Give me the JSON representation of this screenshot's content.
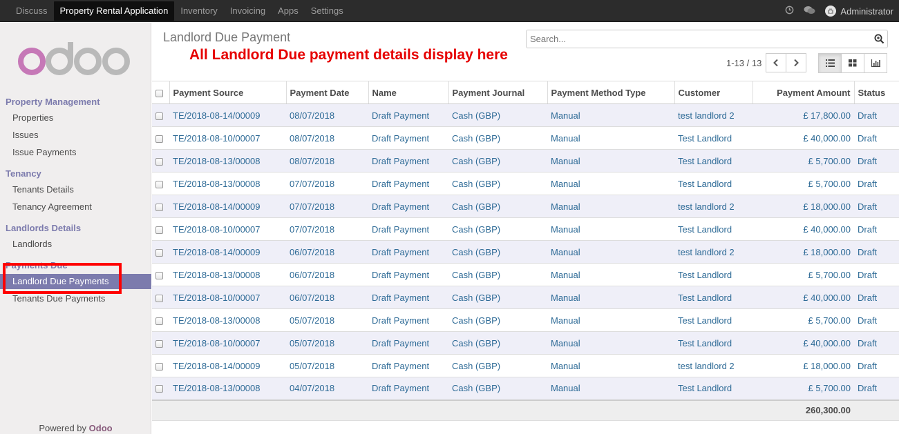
{
  "topbar": {
    "menu": [
      "Discuss",
      "Property Rental Application",
      "Inventory",
      "Invoicing",
      "Apps",
      "Settings"
    ],
    "active_index": 1,
    "icons": [
      "clock-icon",
      "chat-icon"
    ],
    "user": "Administrator"
  },
  "sidebar": {
    "logo_text": "odoo",
    "sections": [
      {
        "title": "Property Management",
        "items": [
          "Properties",
          "Issues",
          "Issue Payments"
        ]
      },
      {
        "title": "Tenancy",
        "items": [
          "Tenants Details",
          "Tenancy Agreement"
        ]
      },
      {
        "title": "Landlords Details",
        "items": [
          "Landlords"
        ]
      },
      {
        "title": "Payments Due",
        "items": [
          "Landlord Due Payments",
          "Tenants Due Payments"
        ]
      }
    ],
    "active_item": "Landlord Due Payments",
    "powered_prefix": "Powered by ",
    "powered_brand": "Odoo"
  },
  "control": {
    "title": "Landlord Due Payment",
    "annotation": "All Landlord Due payment details display here",
    "search_placeholder": "Search...",
    "pager": "1-13 / 13"
  },
  "colors": {
    "accent": "#7c7bad",
    "link": "#2d6a96",
    "annotation": "#e60000",
    "highlight_box": "#ff0000"
  },
  "table": {
    "columns": [
      "Payment Source",
      "Payment Date",
      "Name",
      "Payment Journal",
      "Payment Method Type",
      "Customer",
      "Payment Amount",
      "Status"
    ],
    "rows": [
      [
        "TE/2018-08-14/00009",
        "08/07/2018",
        "Draft Payment",
        "Cash (GBP)",
        "Manual",
        "test landlord 2",
        "£ 17,800.00",
        "Draft"
      ],
      [
        "TE/2018-08-10/00007",
        "08/07/2018",
        "Draft Payment",
        "Cash (GBP)",
        "Manual",
        "Test Landlord",
        "£ 40,000.00",
        "Draft"
      ],
      [
        "TE/2018-08-13/00008",
        "08/07/2018",
        "Draft Payment",
        "Cash (GBP)",
        "Manual",
        "Test Landlord",
        "£ 5,700.00",
        "Draft"
      ],
      [
        "TE/2018-08-13/00008",
        "07/07/2018",
        "Draft Payment",
        "Cash (GBP)",
        "Manual",
        "Test Landlord",
        "£ 5,700.00",
        "Draft"
      ],
      [
        "TE/2018-08-14/00009",
        "07/07/2018",
        "Draft Payment",
        "Cash (GBP)",
        "Manual",
        "test landlord 2",
        "£ 18,000.00",
        "Draft"
      ],
      [
        "TE/2018-08-10/00007",
        "07/07/2018",
        "Draft Payment",
        "Cash (GBP)",
        "Manual",
        "Test Landlord",
        "£ 40,000.00",
        "Draft"
      ],
      [
        "TE/2018-08-14/00009",
        "06/07/2018",
        "Draft Payment",
        "Cash (GBP)",
        "Manual",
        "test landlord 2",
        "£ 18,000.00",
        "Draft"
      ],
      [
        "TE/2018-08-13/00008",
        "06/07/2018",
        "Draft Payment",
        "Cash (GBP)",
        "Manual",
        "Test Landlord",
        "£ 5,700.00",
        "Draft"
      ],
      [
        "TE/2018-08-10/00007",
        "06/07/2018",
        "Draft Payment",
        "Cash (GBP)",
        "Manual",
        "Test Landlord",
        "£ 40,000.00",
        "Draft"
      ],
      [
        "TE/2018-08-13/00008",
        "05/07/2018",
        "Draft Payment",
        "Cash (GBP)",
        "Manual",
        "Test Landlord",
        "£ 5,700.00",
        "Draft"
      ],
      [
        "TE/2018-08-10/00007",
        "05/07/2018",
        "Draft Payment",
        "Cash (GBP)",
        "Manual",
        "Test Landlord",
        "£ 40,000.00",
        "Draft"
      ],
      [
        "TE/2018-08-14/00009",
        "05/07/2018",
        "Draft Payment",
        "Cash (GBP)",
        "Manual",
        "test landlord 2",
        "£ 18,000.00",
        "Draft"
      ],
      [
        "TE/2018-08-13/00008",
        "04/07/2018",
        "Draft Payment",
        "Cash (GBP)",
        "Manual",
        "Test Landlord",
        "£ 5,700.00",
        "Draft"
      ]
    ],
    "total": "260,300.00"
  }
}
